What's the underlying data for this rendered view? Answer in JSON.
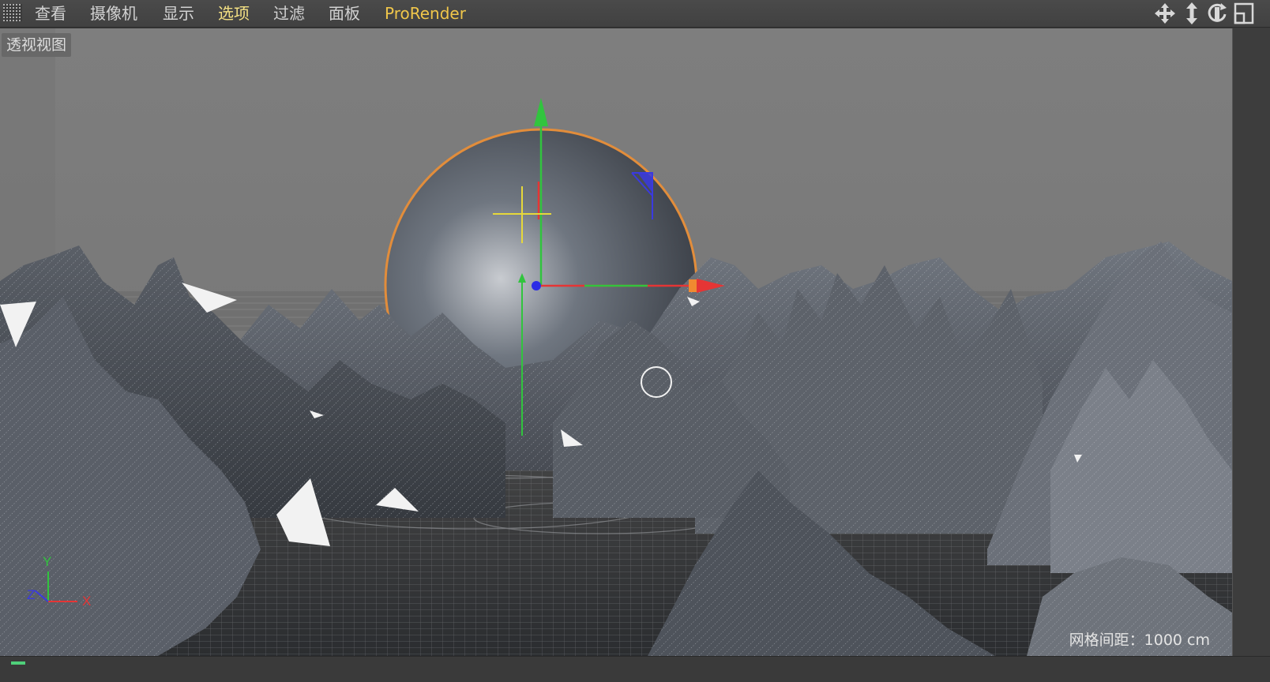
{
  "menubar": {
    "items": [
      "查看",
      "摄像机",
      "显示",
      "选项",
      "过滤",
      "面板",
      "ProRender"
    ],
    "active_index": 3,
    "tools": [
      "move-view-icon",
      "dolly-view-icon",
      "rotate-view-icon",
      "toggle-layout-icon"
    ]
  },
  "viewport": {
    "label": "透视视图",
    "grid_spacing": {
      "label": "网格间距",
      "separator": "：",
      "value": "1000 cm"
    },
    "axis_labels": {
      "y": "Y",
      "z": "Z",
      "x": "X"
    }
  },
  "colors": {
    "menu_text": "#d2d2d2",
    "menu_active": "#f3e083",
    "prorender": "#f0c64a",
    "axis_x": "#e53535",
    "axis_y": "#31c43e",
    "axis_z": "#3a3ae0",
    "selection_outline": "#e28d3b"
  }
}
